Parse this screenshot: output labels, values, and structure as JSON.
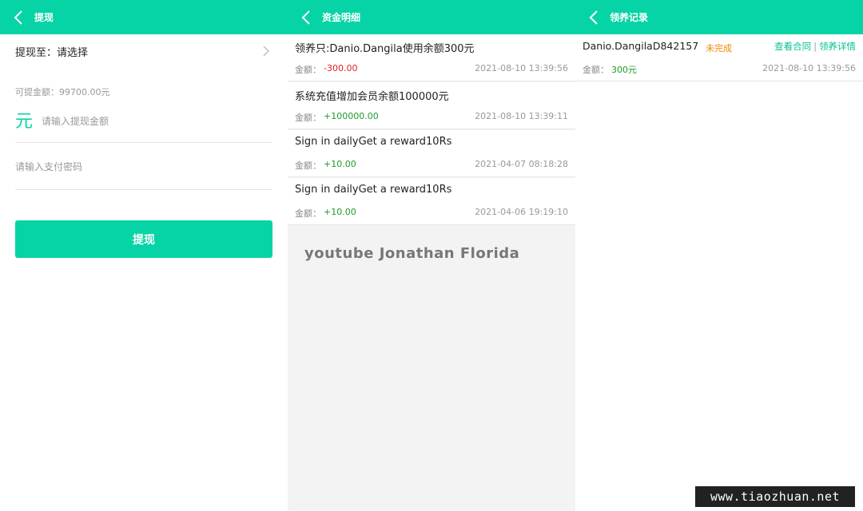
{
  "withdraw": {
    "title": "提现",
    "target_label": "提现至：请选择",
    "available": "可提金额：99700.00元",
    "currency_symbol": "元",
    "amount_placeholder": "请输入提现金额",
    "password_placeholder": "请输入支付密码",
    "submit_label": "提现",
    "accent_color": "#07d4a6"
  },
  "funds": {
    "title": "资金明细",
    "amount_label": "金额：",
    "records": [
      {
        "title": "领养只:Danio.Dangila使用余额300元",
        "amount": "-300.00",
        "time": "2021-08-10 13:39:56",
        "sign": "negative"
      },
      {
        "title": "系统充值增加会员余额100000元",
        "amount": "+100000.00",
        "time": "2021-08-10 13:39:11",
        "sign": "positive"
      },
      {
        "title": "Sign in dailyGet a reward10Rs",
        "amount": "+10.00",
        "time": "2021-04-07 08:18:28",
        "sign": "positive"
      },
      {
        "title": "Sign in dailyGet a reward10Rs",
        "amount": "+10.00",
        "time": "2021-04-06 19:19:10",
        "sign": "positive"
      }
    ],
    "watermark": "youtube Jonathan Florida"
  },
  "adoption": {
    "title": "领养记录",
    "records": [
      {
        "name": "Danio.DangilaD842157",
        "status": "未完成",
        "view_contract": "查看合同",
        "separator": "|",
        "adopt_details": "领养详情",
        "amount_label": "金额：",
        "amount": "300元",
        "time": "2021-08-10 13:39:56"
      }
    ]
  },
  "site_watermark": "www.tiaozhuan.net",
  "icons": {
    "back": "chevron-left-icon",
    "chevron": "chevron-right-icon"
  }
}
